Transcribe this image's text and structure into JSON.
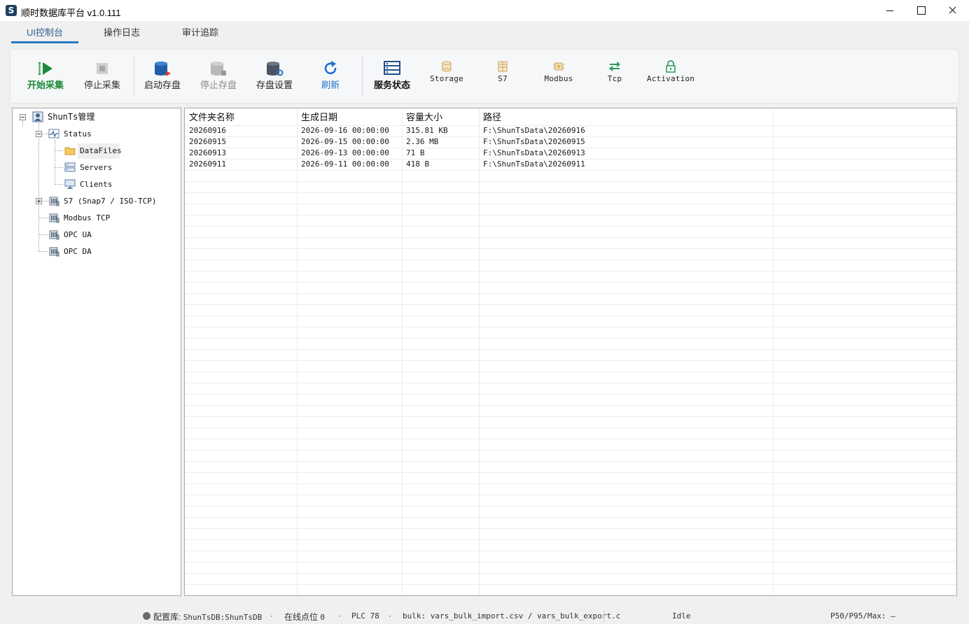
{
  "window": {
    "title": "顺时数据库平台  v1.0.111",
    "logo_letter": "S"
  },
  "tabs": [
    {
      "label": "UI控制台",
      "active": true
    },
    {
      "label": "操作日志",
      "active": false
    },
    {
      "label": "审计追踪",
      "active": false
    }
  ],
  "toolbar": {
    "start_collect": "开始采集",
    "stop_collect": "停止采集",
    "start_storage": "启动存盘",
    "stop_storage": "停止存盘",
    "storage_settings": "存盘设置",
    "refresh": "刷新",
    "service_status": "服务状态",
    "storage": "Storage",
    "s7": "S7",
    "modbus": "Modbus",
    "tcp": "Tcp",
    "activation": "Activation"
  },
  "tree": {
    "root": "ShunTs管理",
    "status": "Status",
    "datafiles": "DataFiles",
    "servers": "Servers",
    "clients": "Clients",
    "s7": "S7 (Snap7 / ISO-TCP)",
    "modbus": "Modbus TCP",
    "opcua": "OPC UA",
    "opcda": "OPC DA"
  },
  "grid": {
    "columns": [
      "文件夹名称",
      "生成日期",
      "容量大小",
      "路径"
    ],
    "rows": [
      [
        "20260916",
        "2026-09-16 00:00:00",
        "315.81 KB",
        "F:\\ShunTsData\\20260916"
      ],
      [
        "20260915",
        "2026-09-15 00:00:00",
        "2.36 MB",
        "F:\\ShunTsData\\20260915"
      ],
      [
        "20260913",
        "2026-09-13 00:00:00",
        "71 B",
        "F:\\ShunTsData\\20260913"
      ],
      [
        "20260911",
        "2026-09-11 00:00:00",
        "418 B",
        "F:\\ShunTsData\\20260911"
      ]
    ]
  },
  "statusbar": {
    "config_label": "配置库:",
    "config_value": "ShunTsDB:ShunTsDB",
    "sep": "·",
    "online_label": "在线点位",
    "online_value": "0",
    "plc": "PLC 78",
    "bulk": "bulk: vars_bulk_import.csv / vars_bulk_export.c",
    "state": "Idle",
    "latency": "P50/P95/Max: —"
  },
  "colors": {
    "accent": "#2b78c2",
    "start_green": "#1c8a3a",
    "db_blue": "#1f5fa8"
  }
}
